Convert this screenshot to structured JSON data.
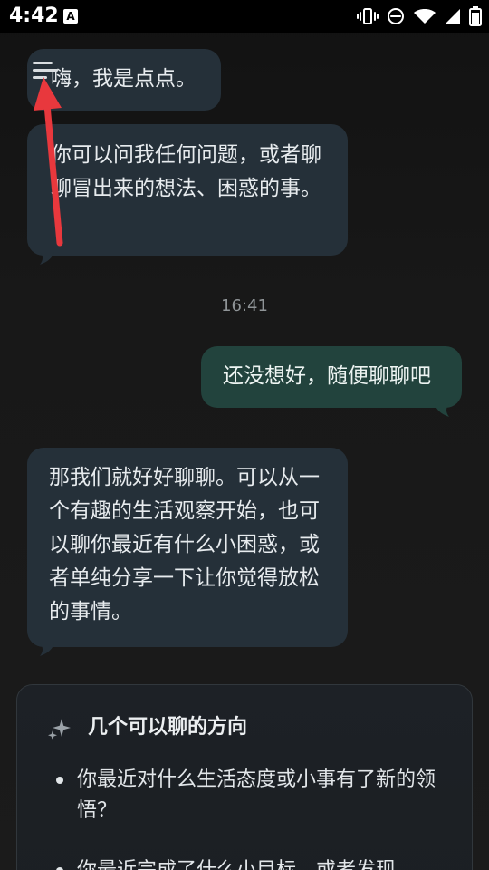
{
  "statusbar": {
    "time": "4:42",
    "app_badge": "A"
  },
  "chat": {
    "messages": [
      {
        "role": "assistant",
        "text": "嗨，我是点点。"
      },
      {
        "role": "assistant",
        "text": "你可以问我任何问题，或者聊聊冒出来的想法、困惑的事。"
      },
      {
        "role": "timestamp",
        "text": "16:41"
      },
      {
        "role": "user",
        "text": "还没想好，随便聊聊吧"
      },
      {
        "role": "assistant",
        "text": "那我们就好好聊聊。可以从一个有趣的生活观察开始，也可以聊你最近有什么小困惑，或者单纯分享一下让你觉得放松的事情。"
      }
    ],
    "suggestions": {
      "title": "几个可以聊的方向",
      "items": [
        "你最近对什么生活态度或小事有了新的领悟？",
        "你最近完成了什么小目标，或者发现"
      ]
    }
  }
}
